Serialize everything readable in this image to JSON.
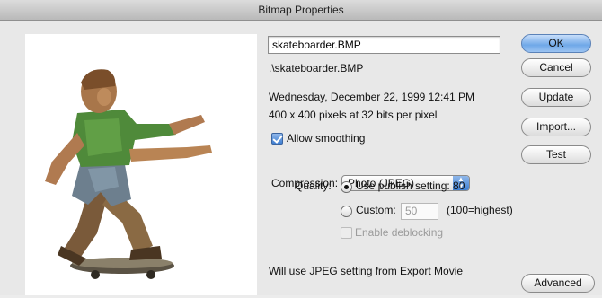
{
  "window": {
    "title": "Bitmap Properties"
  },
  "file": {
    "name_value": ".\\skateboarder.BMP",
    "name_field": "skateboarder.BMP",
    "path": ".\\skateboarder.BMP",
    "date": "Wednesday, December 22, 1999  12:41 PM",
    "dimensions": "400 x 400 pixels at 32 bits per pixel"
  },
  "options": {
    "allow_smoothing": "Allow smoothing",
    "compression_label": "Compression:",
    "compression_value": "Photo (JPEG)",
    "quality_label": "Quality:",
    "use_publish": "Use publish setting: 80",
    "custom_label": "Custom:",
    "custom_value": "50",
    "custom_hint": "(100=highest)",
    "enable_deblocking": "Enable deblocking",
    "note": "Will use JPEG setting from Export Movie"
  },
  "buttons": {
    "ok": "OK",
    "cancel": "Cancel",
    "update": "Update",
    "import": "Import...",
    "test": "Test",
    "advanced": "Advanced"
  },
  "preview": {
    "icon": "skateboarder-image"
  },
  "colors": {
    "accent": "#3f7fd2",
    "default_button": "#6fa8e8"
  }
}
